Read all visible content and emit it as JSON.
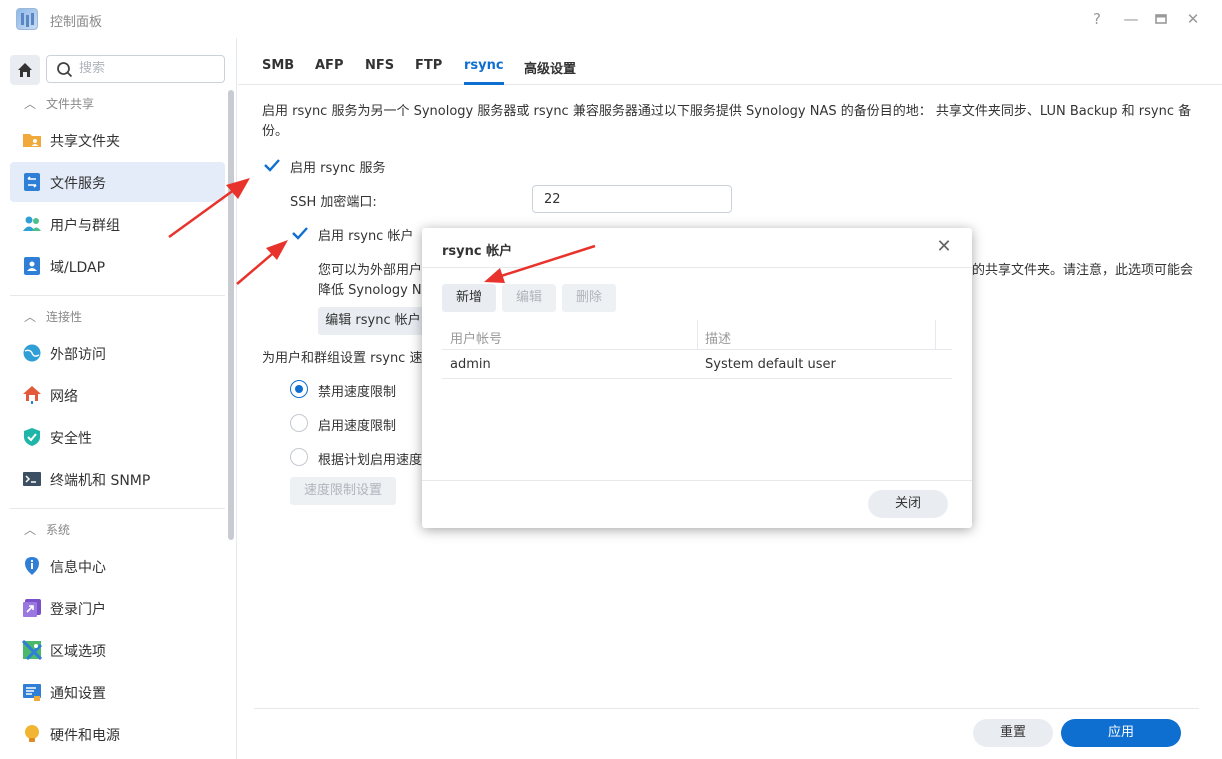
{
  "window": {
    "title": "控制面板",
    "help_icon": "?",
    "minimize_icon": "—",
    "maximize_icon": "▭",
    "close_icon": "✕"
  },
  "sidebar": {
    "search_placeholder": "搜索",
    "sections": [
      {
        "label": "文件共享",
        "items": [
          {
            "label": "共享文件夹",
            "icon": "folder-share-icon",
            "active": false
          },
          {
            "label": "文件服务",
            "icon": "file-services-icon",
            "active": true
          },
          {
            "label": "用户与群组",
            "icon": "users-icon",
            "active": false
          },
          {
            "label": "域/LDAP",
            "icon": "domain-icon",
            "active": false
          }
        ]
      },
      {
        "label": "连接性",
        "items": [
          {
            "label": "外部访问",
            "icon": "external-access-icon"
          },
          {
            "label": "网络",
            "icon": "network-icon"
          },
          {
            "label": "安全性",
            "icon": "shield-icon"
          },
          {
            "label": "终端机和 SNMP",
            "icon": "terminal-icon"
          }
        ]
      },
      {
        "label": "系统",
        "items": [
          {
            "label": "信息中心",
            "icon": "info-icon"
          },
          {
            "label": "登录门户",
            "icon": "login-portal-icon"
          },
          {
            "label": "区域选项",
            "icon": "region-icon"
          },
          {
            "label": "通知设置",
            "icon": "notification-icon"
          },
          {
            "label": "硬件和电源",
            "icon": "bulb-icon"
          }
        ]
      }
    ]
  },
  "tabs": [
    {
      "label": "SMB"
    },
    {
      "label": "AFP"
    },
    {
      "label": "NFS"
    },
    {
      "label": "FTP"
    },
    {
      "label": "rsync",
      "active": true
    },
    {
      "label": "高级设置"
    }
  ],
  "rsync": {
    "description": "启用 rsync 服务为另一个 Synology 服务器或 rsync 兼容服务器通过以下服务提供 Synology NAS 的备份目的地： 共享文件夹同步、LUN Backup 和 rsync 备份。",
    "enable_service_label": "启用 rsync 服务",
    "ssh_port_label": "SSH 加密端口:",
    "ssh_port_value": "22",
    "enable_account_label": "启用 rsync 帐户",
    "account_note_left_1": "您可以为外部用户",
    "account_note_left_2": "降低 Synology N",
    "account_note_right": "的共享文件夹。请注意，此选项可能会",
    "edit_account_button": "编辑 rsync 帐户",
    "speed_heading": "为用户和群组设置 rsync 速",
    "speed_options": [
      {
        "label": "禁用速度限制",
        "checked": true
      },
      {
        "label": "启用速度限制",
        "checked": false
      },
      {
        "label": "根据计划启用速度",
        "checked": false
      }
    ],
    "speed_settings_button": "速度限制设置"
  },
  "footer": {
    "reset_label": "重置",
    "apply_label": "应用"
  },
  "dialog": {
    "title": "rsync 帐户",
    "close_icon": "✕",
    "toolbar": {
      "add": "新增",
      "edit": "编辑",
      "delete": "删除"
    },
    "columns": [
      "用户帐号",
      "描述"
    ],
    "rows": [
      {
        "user": "admin",
        "description": "System default user"
      }
    ],
    "close_button": "关闭"
  },
  "colors": {
    "accent": "#0f6fd1",
    "annotation": "#e8332c",
    "active_bg": "#e3ecf8"
  }
}
